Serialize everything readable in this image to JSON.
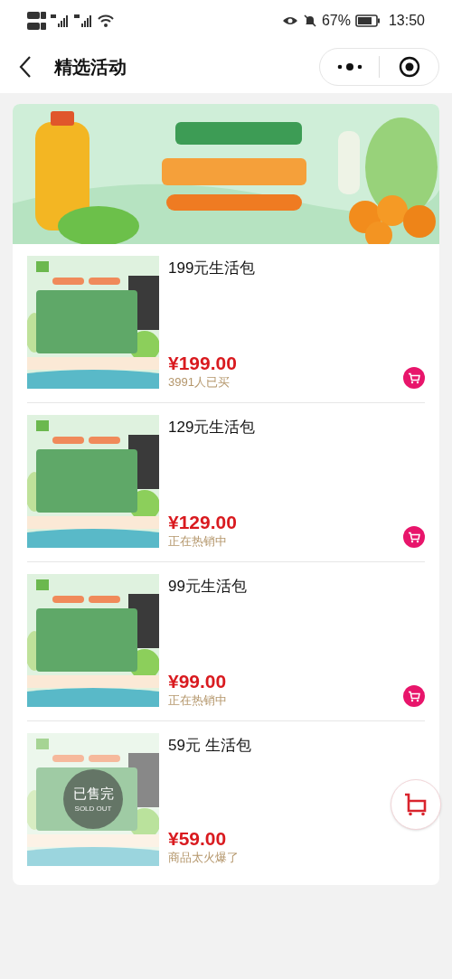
{
  "status_bar": {
    "battery": "67%",
    "time": "13:50"
  },
  "nav_bar": {
    "title": "精选活动"
  },
  "products": [
    {
      "title": "199元生活包",
      "price": "¥199.00",
      "note": "3991人已买",
      "sold_out": false
    },
    {
      "title": "129元生活包",
      "price": "¥129.00",
      "note": "正在热销中",
      "sold_out": false
    },
    {
      "title": "99元生活包",
      "price": "¥99.00",
      "note": "正在热销中",
      "sold_out": false
    },
    {
      "title": "59元 生活包",
      "price": "¥59.00",
      "note": "商品太火爆了",
      "sold_out": true,
      "sold_out_badge": {
        "label": "已售完",
        "sublabel": "SOLD OUT"
      }
    }
  ]
}
